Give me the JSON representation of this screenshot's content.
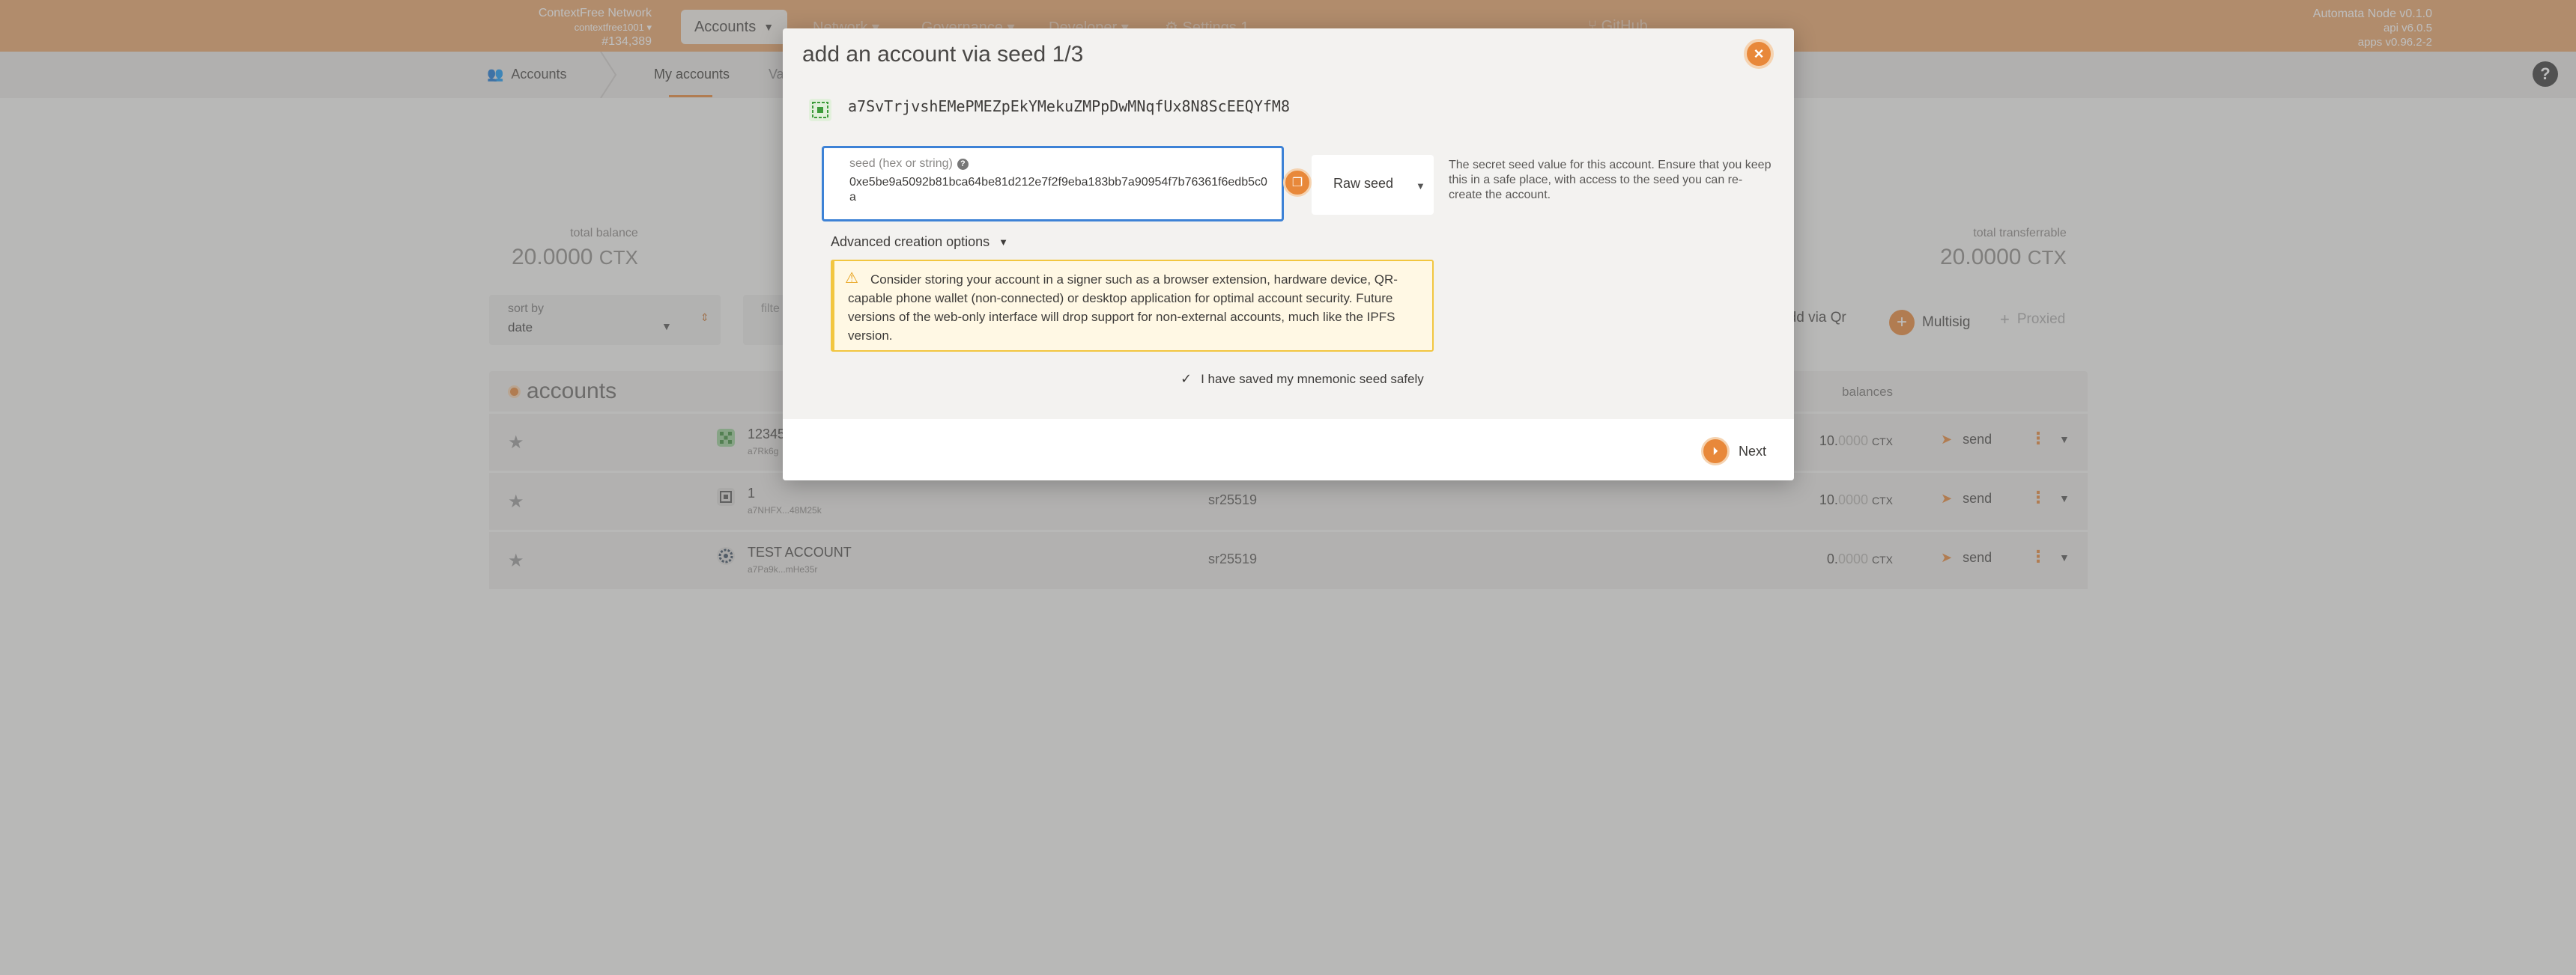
{
  "topbar": {
    "chain_name": "ContextFree Network",
    "chain_spec": "contextfree1001",
    "block": "#134,389",
    "accounts_tab": "Accounts",
    "network_tab": "Network",
    "governance_tab": "Governance",
    "developer_tab": "Developer",
    "settings_tab": "Settings",
    "settings_badge": "1",
    "github": "GitHub",
    "node_version": "Automata Node v0.1.0",
    "api_version": "api v6.0.5",
    "apps_version": "apps v0.96.2-2"
  },
  "subbar": {
    "section": "Accounts",
    "my_accounts": "My accounts",
    "vaults": "Va"
  },
  "stats": {
    "total_balance_label": "total balance",
    "total_balance_int": "20.0000",
    "total_balance_unit": "CTX",
    "total_transferrable_label": "total transferrable",
    "total_transferrable_int": "20.0000",
    "total_transferrable_unit": "CTX"
  },
  "filters": {
    "sort_label": "sort by",
    "sort_value": "date",
    "filter_label": "filte"
  },
  "actions": {
    "add_via_qr": "Add via Qr",
    "multisig": "Multisig",
    "proxied": "Proxied"
  },
  "table": {
    "title": "accounts",
    "balances_header": "balances",
    "rows": [
      {
        "name": "12345",
        "address": "a7Rk6g",
        "type": "",
        "balance_int": "10.",
        "balance_dec": "0000",
        "unit": "CTX",
        "send": "send"
      },
      {
        "name": "1",
        "address": "a7NHFX...48M25k",
        "type": "sr25519",
        "balance_int": "10.",
        "balance_dec": "0000",
        "unit": "CTX",
        "send": "send"
      },
      {
        "name": "TEST ACCOUNT",
        "address": "a7Pa9k...mHe35r",
        "type": "sr25519",
        "balance_int": "0.",
        "balance_dec": "0000",
        "unit": "CTX",
        "send": "send"
      }
    ]
  },
  "modal": {
    "title": "add an account via seed 1/3",
    "address": "a7SvTrjvshEMePMEZpEkYMekuZMPpDwMNqfUx8N8ScEEQYfM8",
    "seed_label": "seed (hex or string)",
    "seed_value": "0xe5be9a5092b81bca64be81d212e7f2f9eba183bb7a90954f7b76361f6edb5c0a",
    "seed_type": "Raw seed",
    "help_text": "The secret seed value for this account. Ensure that you keep this in a safe place, with access to the seed you can re-create the account.",
    "advanced": "Advanced creation options",
    "warning": "Consider storing your account in a signer such as a browser extension, hardware device, QR-capable phone wallet (non-connected) or desktop application for optimal account security. Future versions of the web-only interface will drop support for non-external accounts, much like the IPFS version.",
    "saved_label": "I have saved my mnemonic seed safely",
    "next": "Next"
  },
  "colors": {
    "brand": "#e8883a",
    "topbar": "#e8a56b",
    "focus": "#3d82d6",
    "warning_border": "#f2c640"
  }
}
